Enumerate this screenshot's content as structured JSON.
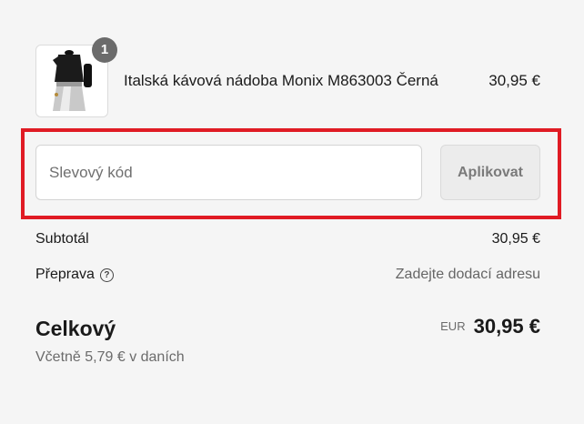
{
  "cart": {
    "item": {
      "quantity": "1",
      "name": "Italská kávová nádoba Monix M863003 Černá",
      "price": "30,95 €"
    }
  },
  "discount": {
    "placeholder": "Slevový kód",
    "apply_label": "Aplikovat"
  },
  "summary": {
    "subtotal_label": "Subtotál",
    "subtotal_value": "30,95 €",
    "shipping_label": "Přeprava",
    "shipping_value": "Zadejte dodací adresu",
    "total_label": "Celkový",
    "currency": "EUR",
    "total_value": "30,95 €",
    "tax_note": "Včetně 5,79 € v daních"
  },
  "colors": {
    "highlight": "#e01b24",
    "badge": "#6b6b6b",
    "background": "#f5f5f5"
  },
  "icons": {
    "shipping_help": "question-circle-icon"
  }
}
